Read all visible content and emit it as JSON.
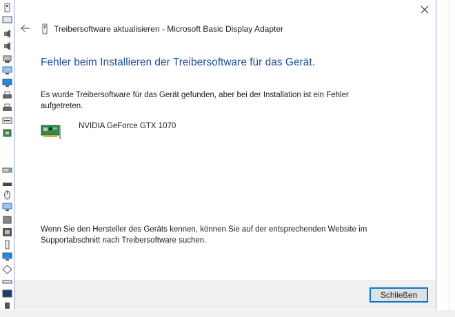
{
  "dialog": {
    "title": "Treibersoftware aktualisieren - Microsoft Basic Display Adapter",
    "heading": "Fehler beim Installieren der Treibersoftware für das Gerät.",
    "message": "Es wurde Treibersoftware für das Gerät gefunden, aber bei der Installation ist ein Fehler aufgetreten.",
    "device": {
      "name": "NVIDIA GeForce GTX 1070",
      "icon": "graphics-card-icon"
    },
    "hint": "Wenn Sie den Hersteller des Geräts kennen, können Sie auf der entsprechenden Website im Supportabschnitt nach Treibersoftware suchen.",
    "close_button_label": "Schließen"
  },
  "colors": {
    "heading": "#1e4e96",
    "button_border": "#0078d7",
    "footer_bg": "#f0f0f0"
  },
  "background_icons": [
    "usb-icon",
    "display-icon",
    "speaker-icon",
    "network-icon",
    "monitor-icon",
    "printer-icon",
    "keyboard-icon",
    "processor-icon",
    "audio-icon",
    "disk-drive-icon",
    "mouse-icon",
    "storage-icon",
    "memory-icon",
    "battery-icon",
    "system-icon"
  ]
}
